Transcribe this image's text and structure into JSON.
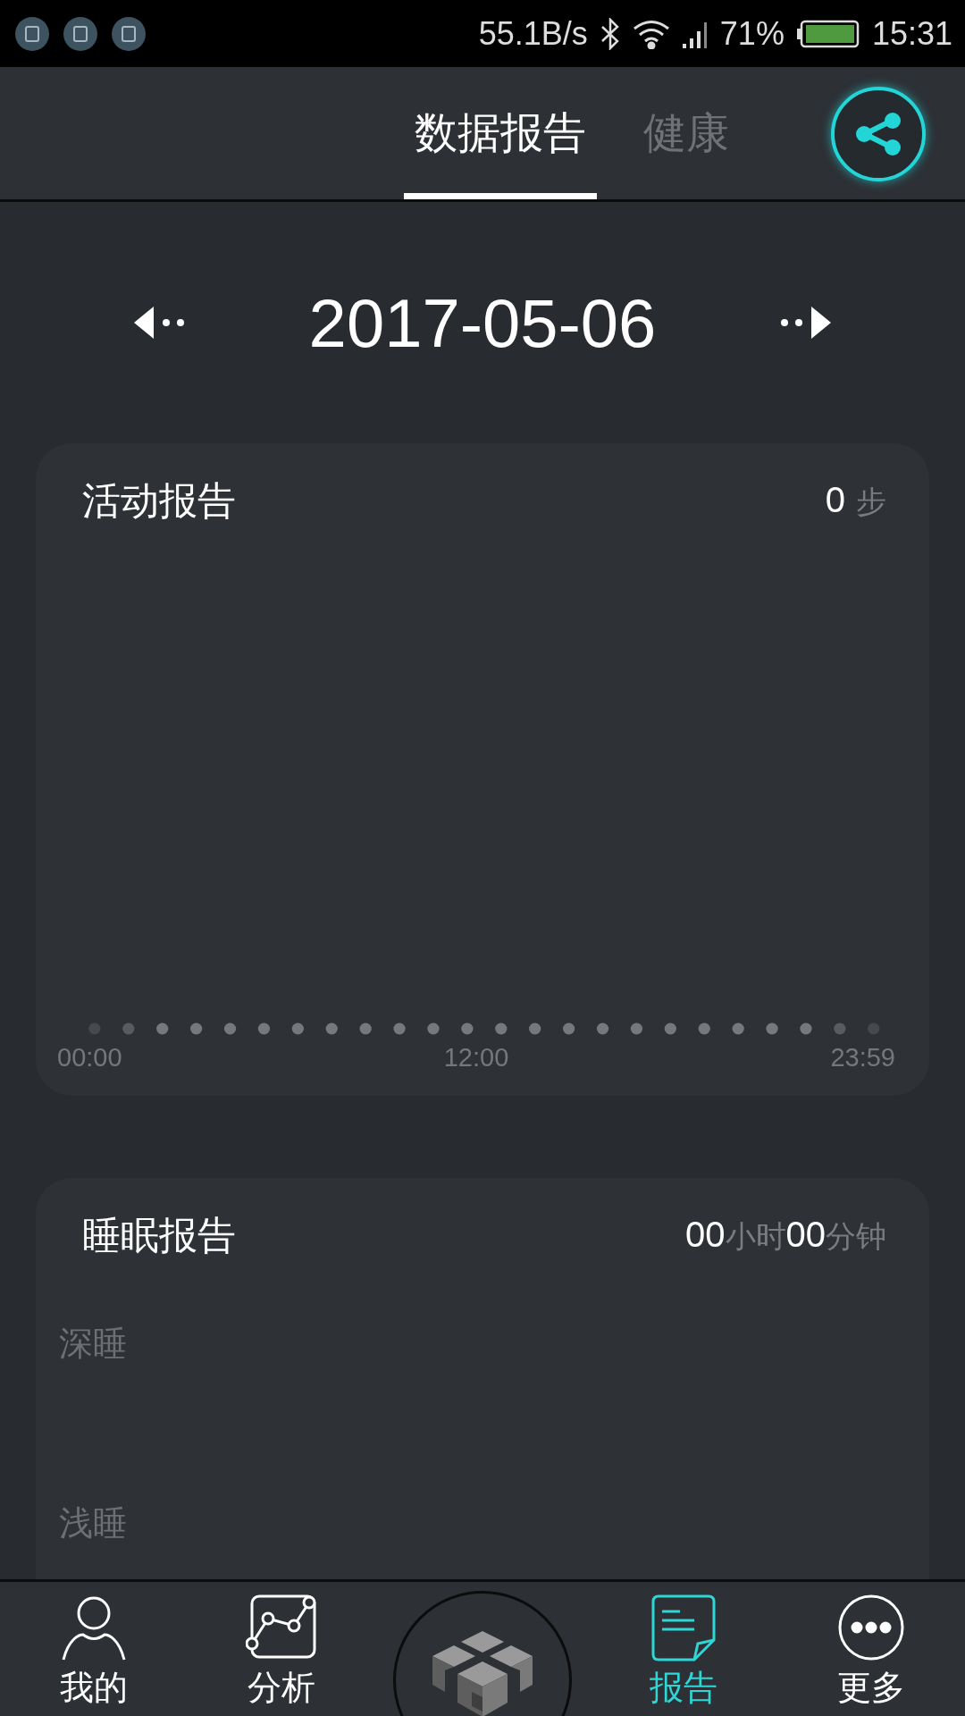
{
  "status_bar": {
    "net_speed": "55.1B/s",
    "battery": "71%",
    "time": "15:31"
  },
  "header": {
    "tabs": [
      {
        "label": "数据报告",
        "selected": true
      },
      {
        "label": "健康",
        "selected": false
      }
    ]
  },
  "date_nav": {
    "date": "2017-05-06"
  },
  "activity_card": {
    "title": "活动报告",
    "value": "0",
    "unit": "步",
    "axis_labels": [
      "00:00",
      "12:00",
      "23:59"
    ]
  },
  "sleep_card": {
    "title": "睡眠报告",
    "duration": [
      {
        "text": "00",
        "kind": "number"
      },
      {
        "text": "小时",
        "kind": "unit"
      },
      {
        "text": "00",
        "kind": "number"
      },
      {
        "text": "分钟",
        "kind": "unit"
      }
    ],
    "stages": [
      "深睡",
      "浅睡"
    ]
  },
  "bottom_nav": {
    "items": [
      {
        "label": "我的",
        "kind": "person",
        "selected": false
      },
      {
        "label": "分析",
        "kind": "chart",
        "selected": false
      },
      {
        "label": "报告",
        "kind": "report",
        "selected": true
      },
      {
        "label": "更多",
        "kind": "more",
        "selected": false
      }
    ]
  }
}
